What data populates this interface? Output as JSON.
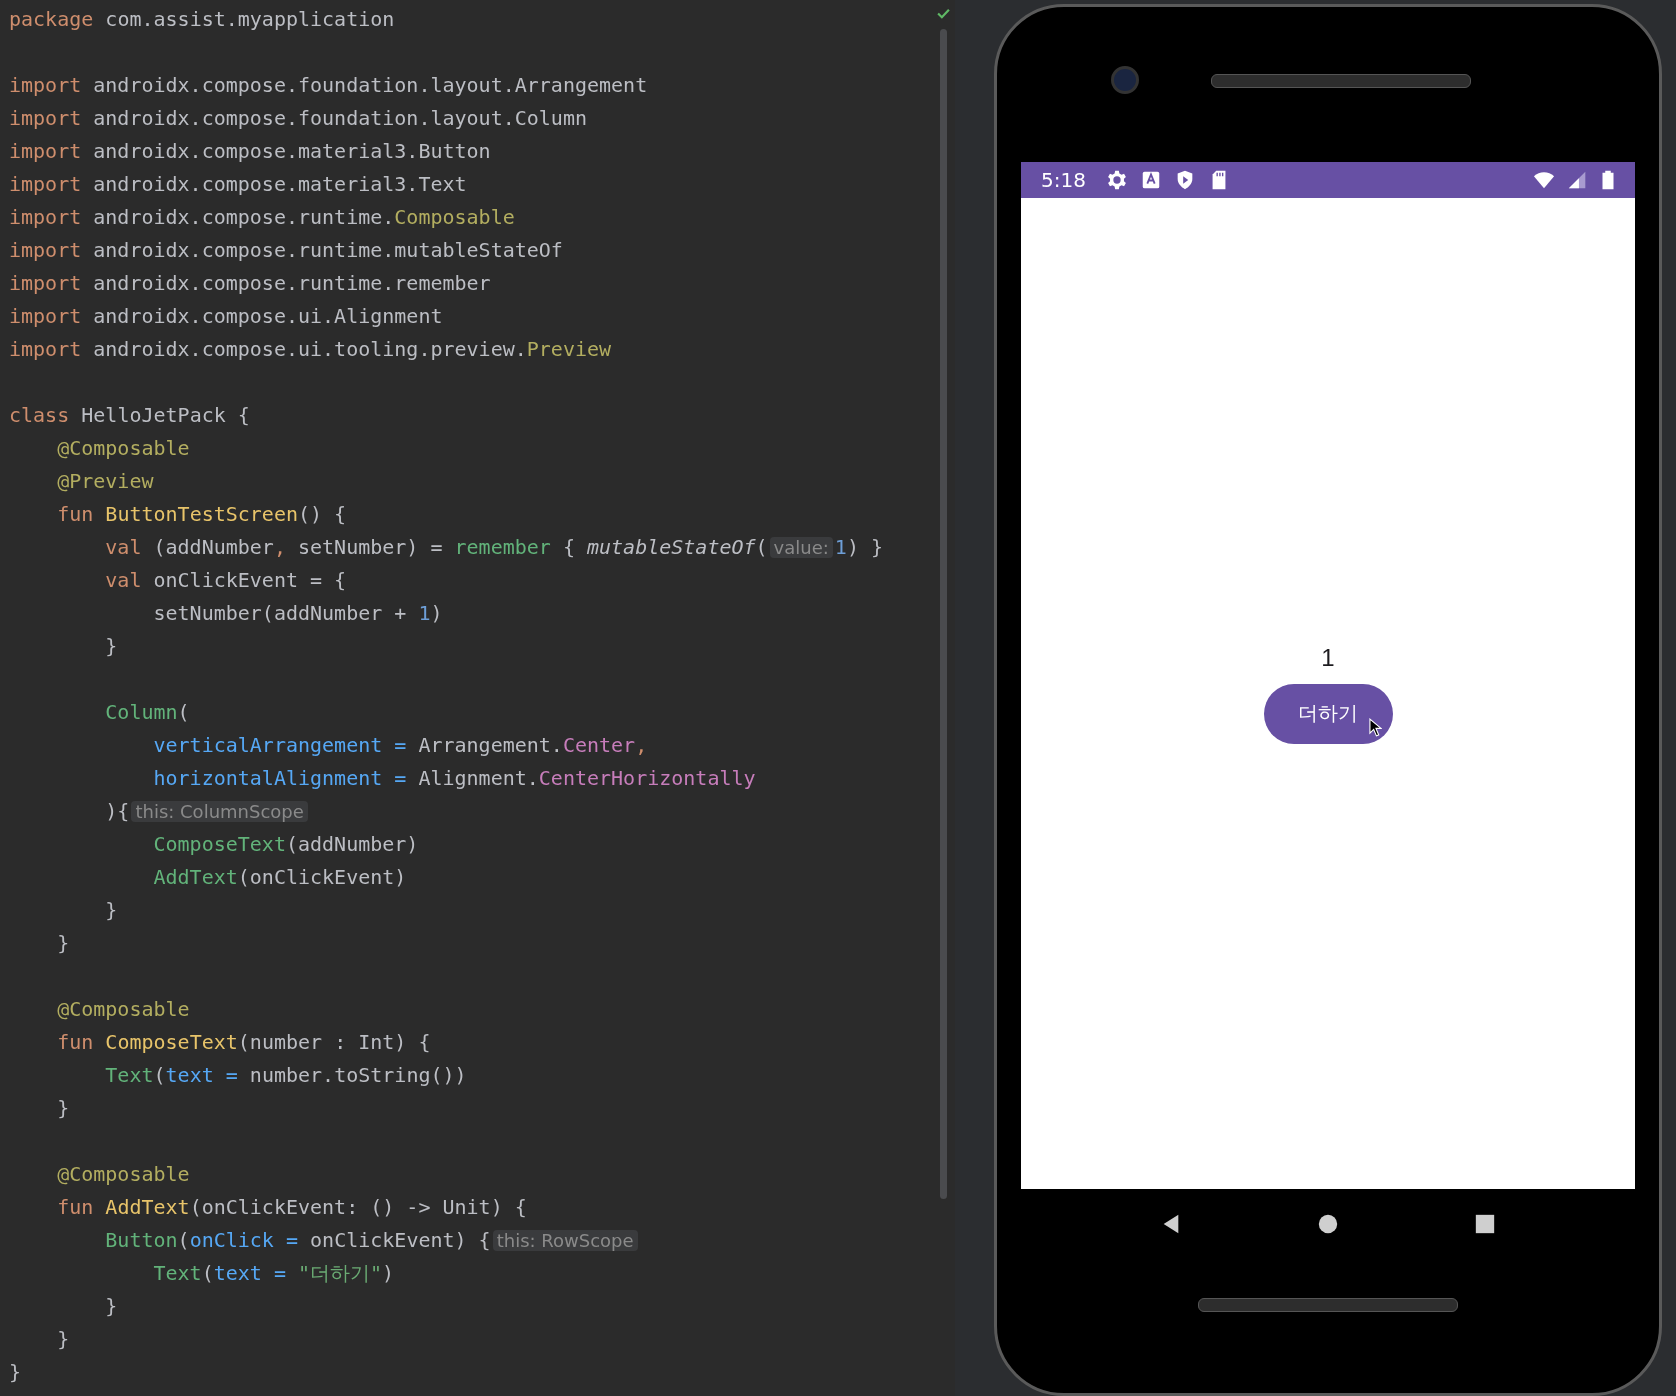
{
  "editor": {
    "status_ok": true,
    "lines": [
      {
        "tokens": [
          {
            "t": "package",
            "kind": "kw"
          },
          {
            "t": " com.assist.myapplication",
            "kind": "plain"
          }
        ]
      },
      {
        "blank_before": true,
        "tokens": [
          {
            "t": "import",
            "kind": "kw"
          },
          {
            "t": " androidx.compose.foundation.layout.Arrangement",
            "kind": "plain"
          }
        ]
      },
      {
        "tokens": [
          {
            "t": "import",
            "kind": "kw"
          },
          {
            "t": " androidx.compose.foundation.layout.Column",
            "kind": "plain"
          }
        ]
      },
      {
        "tokens": [
          {
            "t": "import",
            "kind": "kw"
          },
          {
            "t": " androidx.compose.material3.Button",
            "kind": "plain"
          }
        ]
      },
      {
        "tokens": [
          {
            "t": "import",
            "kind": "kw"
          },
          {
            "t": " androidx.compose.material3.Text",
            "kind": "plain"
          }
        ]
      },
      {
        "tokens": [
          {
            "t": "import",
            "kind": "kw"
          },
          {
            "t": " androidx.compose.runtime.",
            "kind": "plain"
          },
          {
            "t": "Composable",
            "kind": "ann"
          }
        ]
      },
      {
        "tokens": [
          {
            "t": "import",
            "kind": "kw"
          },
          {
            "t": " androidx.compose.runtime.mutableStateOf",
            "kind": "plain"
          }
        ]
      },
      {
        "tokens": [
          {
            "t": "import",
            "kind": "kw"
          },
          {
            "t": " androidx.compose.runtime.remember",
            "kind": "plain"
          }
        ]
      },
      {
        "tokens": [
          {
            "t": "import",
            "kind": "kw"
          },
          {
            "t": " androidx.compose.ui.Alignment",
            "kind": "plain"
          }
        ]
      },
      {
        "tokens": [
          {
            "t": "import",
            "kind": "kw"
          },
          {
            "t": " androidx.compose.ui.tooling.preview.",
            "kind": "plain"
          },
          {
            "t": "Preview",
            "kind": "ann"
          }
        ]
      },
      {
        "blank_before": true,
        "tokens": [
          {
            "t": "class",
            "kind": "kw"
          },
          {
            "t": " HelloJetPack {",
            "kind": "plain"
          }
        ]
      },
      {
        "tokens": [
          {
            "t": "    @Composable",
            "kind": "ann"
          }
        ]
      },
      {
        "tokens": [
          {
            "t": "    @Preview",
            "kind": "ann"
          }
        ]
      },
      {
        "tokens": [
          {
            "t": "    fun",
            "kind": "kw"
          },
          {
            "t": " ButtonTestScreen",
            "kind": "decl"
          },
          {
            "t": "() {",
            "kind": "plain"
          }
        ]
      },
      {
        "tokens": [
          {
            "t": "        val",
            "kind": "kw"
          },
          {
            "t": " (addNumber",
            "kind": "plain"
          },
          {
            "t": ",",
            "kind": "kw"
          },
          {
            "t": " setNumber) = ",
            "kind": "plain"
          },
          {
            "t": "remember",
            "kind": "call"
          },
          {
            "t": " { ",
            "kind": "plain"
          },
          {
            "t": "mutableStateOf",
            "kind": "italic"
          },
          {
            "t": "(",
            "kind": "plain"
          },
          {
            "t": "value:",
            "kind": "hint"
          },
          {
            "t": "1",
            "kind": "num"
          },
          {
            "t": ") }",
            "kind": "plain"
          }
        ]
      },
      {
        "tokens": [
          {
            "t": "        val",
            "kind": "kw"
          },
          {
            "t": " onClickEvent = {",
            "kind": "plain"
          }
        ]
      },
      {
        "tokens": [
          {
            "t": "            setNumber(addNumber + ",
            "kind": "plain"
          },
          {
            "t": "1",
            "kind": "num"
          },
          {
            "t": ")",
            "kind": "plain"
          }
        ]
      },
      {
        "tokens": [
          {
            "t": "        }",
            "kind": "plain"
          }
        ]
      },
      {
        "blank_before": true,
        "tokens": [
          {
            "t": "        Column",
            "kind": "call"
          },
          {
            "t": "(",
            "kind": "plain"
          }
        ]
      },
      {
        "tokens": [
          {
            "t": "            verticalArrangement = ",
            "kind": "named"
          },
          {
            "t": "Arrangement.",
            "kind": "plain"
          },
          {
            "t": "Center",
            "kind": "prop"
          },
          {
            "t": ",",
            "kind": "kw"
          }
        ]
      },
      {
        "tokens": [
          {
            "t": "            horizontalAlignment = ",
            "kind": "named"
          },
          {
            "t": "Alignment.",
            "kind": "plain"
          },
          {
            "t": "CenterHorizontally",
            "kind": "prop"
          }
        ]
      },
      {
        "tokens": [
          {
            "t": "        ){",
            "kind": "plain"
          },
          {
            "t": "this: ColumnScope",
            "kind": "hint"
          }
        ]
      },
      {
        "tokens": [
          {
            "t": "            ComposeText",
            "kind": "call"
          },
          {
            "t": "(addNumber)",
            "kind": "plain"
          }
        ]
      },
      {
        "tokens": [
          {
            "t": "            AddText",
            "kind": "call"
          },
          {
            "t": "(onClickEvent)",
            "kind": "plain"
          }
        ]
      },
      {
        "tokens": [
          {
            "t": "        }",
            "kind": "plain"
          }
        ]
      },
      {
        "tokens": [
          {
            "t": "    }",
            "kind": "plain"
          }
        ]
      },
      {
        "blank_before": true,
        "tokens": [
          {
            "t": "    @Composable",
            "kind": "ann"
          }
        ]
      },
      {
        "tokens": [
          {
            "t": "    fun",
            "kind": "kw"
          },
          {
            "t": " ComposeText",
            "kind": "decl"
          },
          {
            "t": "(number : Int) {",
            "kind": "plain"
          }
        ]
      },
      {
        "tokens": [
          {
            "t": "        Text",
            "kind": "call"
          },
          {
            "t": "(",
            "kind": "plain"
          },
          {
            "t": "text = ",
            "kind": "named"
          },
          {
            "t": "number.toString())",
            "kind": "plain"
          }
        ]
      },
      {
        "tokens": [
          {
            "t": "    }",
            "kind": "plain"
          }
        ]
      },
      {
        "blank_before": true,
        "tokens": [
          {
            "t": "    @Composable",
            "kind": "ann"
          }
        ]
      },
      {
        "tokens": [
          {
            "t": "    fun",
            "kind": "kw"
          },
          {
            "t": " AddText",
            "kind": "decl"
          },
          {
            "t": "(onClickEvent: () -> Unit) {",
            "kind": "plain"
          }
        ]
      },
      {
        "tokens": [
          {
            "t": "        Button",
            "kind": "call"
          },
          {
            "t": "(",
            "kind": "plain"
          },
          {
            "t": "onClick = ",
            "kind": "named"
          },
          {
            "t": "onClickEvent) {",
            "kind": "plain"
          },
          {
            "t": "this: RowScope",
            "kind": "hint"
          }
        ]
      },
      {
        "tokens": [
          {
            "t": "            Text",
            "kind": "call"
          },
          {
            "t": "(",
            "kind": "plain"
          },
          {
            "t": "text = ",
            "kind": "named"
          },
          {
            "t": "\"더하기\"",
            "kind": "str"
          },
          {
            "t": ")",
            "kind": "plain"
          }
        ]
      },
      {
        "tokens": [
          {
            "t": "        }",
            "kind": "plain"
          }
        ]
      },
      {
        "tokens": [
          {
            "t": "    }",
            "kind": "plain"
          }
        ]
      },
      {
        "tokens": [
          {
            "t": "}",
            "kind": "plain"
          }
        ]
      }
    ]
  },
  "phone": {
    "status_bar": {
      "time": "5:18"
    },
    "screen": {
      "counter": "1",
      "button": "더하기"
    }
  }
}
